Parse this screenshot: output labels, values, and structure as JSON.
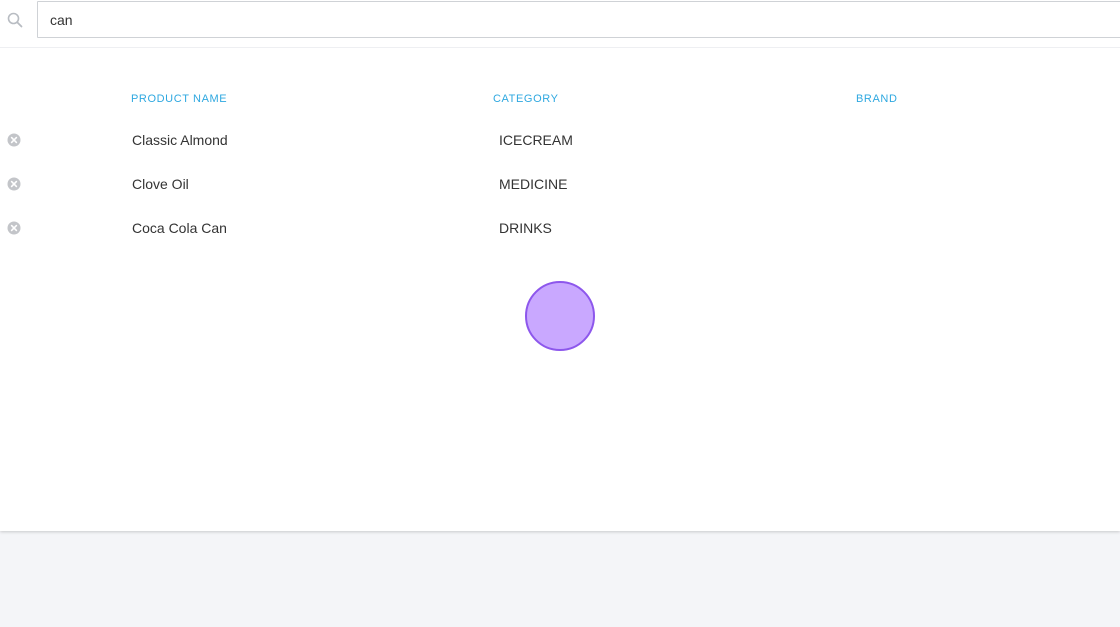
{
  "search": {
    "value": "can",
    "icon": "search-icon"
  },
  "table": {
    "columns": [
      "PRODUCT NAME",
      "CATEGORY",
      "BRAND"
    ],
    "rows": [
      {
        "product": "Classic Almond",
        "category": "ICECREAM",
        "brand": ""
      },
      {
        "product": "Clove Oil",
        "category": "MEDICINE",
        "brand": ""
      },
      {
        "product": "Coca Cola Can",
        "category": "DRINKS",
        "brand": ""
      }
    ],
    "header_color": "#2fa8e0"
  },
  "touch_indicator": {
    "color": "#c9a8ff",
    "border": "#8d57ec"
  }
}
